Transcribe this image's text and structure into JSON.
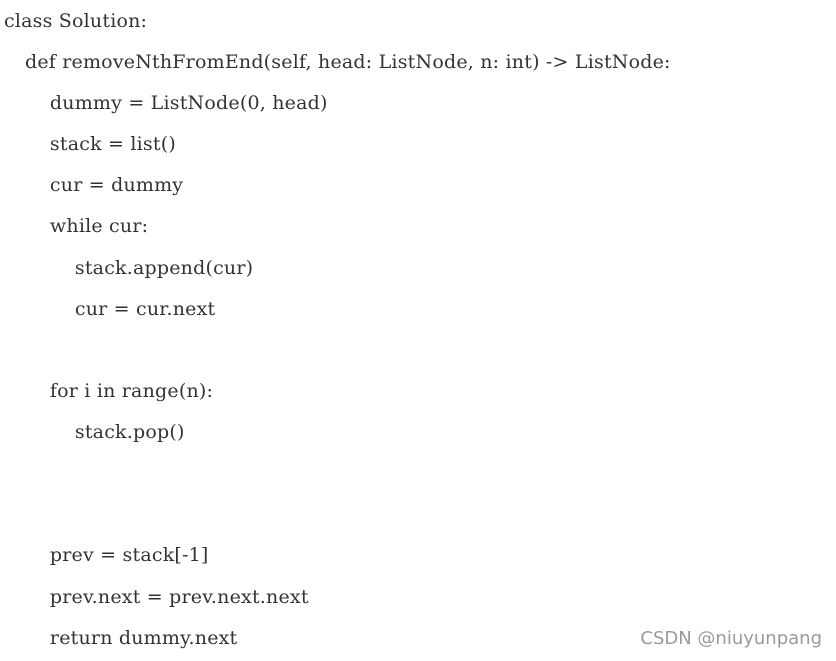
{
  "code": {
    "lines": [
      "class Solution:",
      "    def removeNthFromEnd(self, head: ListNode, n: int) -> ListNode:",
      "        dummy = ListNode(0, head)",
      "        stack = list()",
      "        cur = dummy",
      "        while cur:",
      "            stack.append(cur)",
      "            cur = cur.next",
      "",
      "        for i in range(n):",
      "            stack.pop()",
      "",
      "",
      "        prev = stack[-1]",
      "        prev.next = prev.next.next",
      "        return dummy.next"
    ]
  },
  "watermark": {
    "text": "CSDN @niuyunpang"
  }
}
